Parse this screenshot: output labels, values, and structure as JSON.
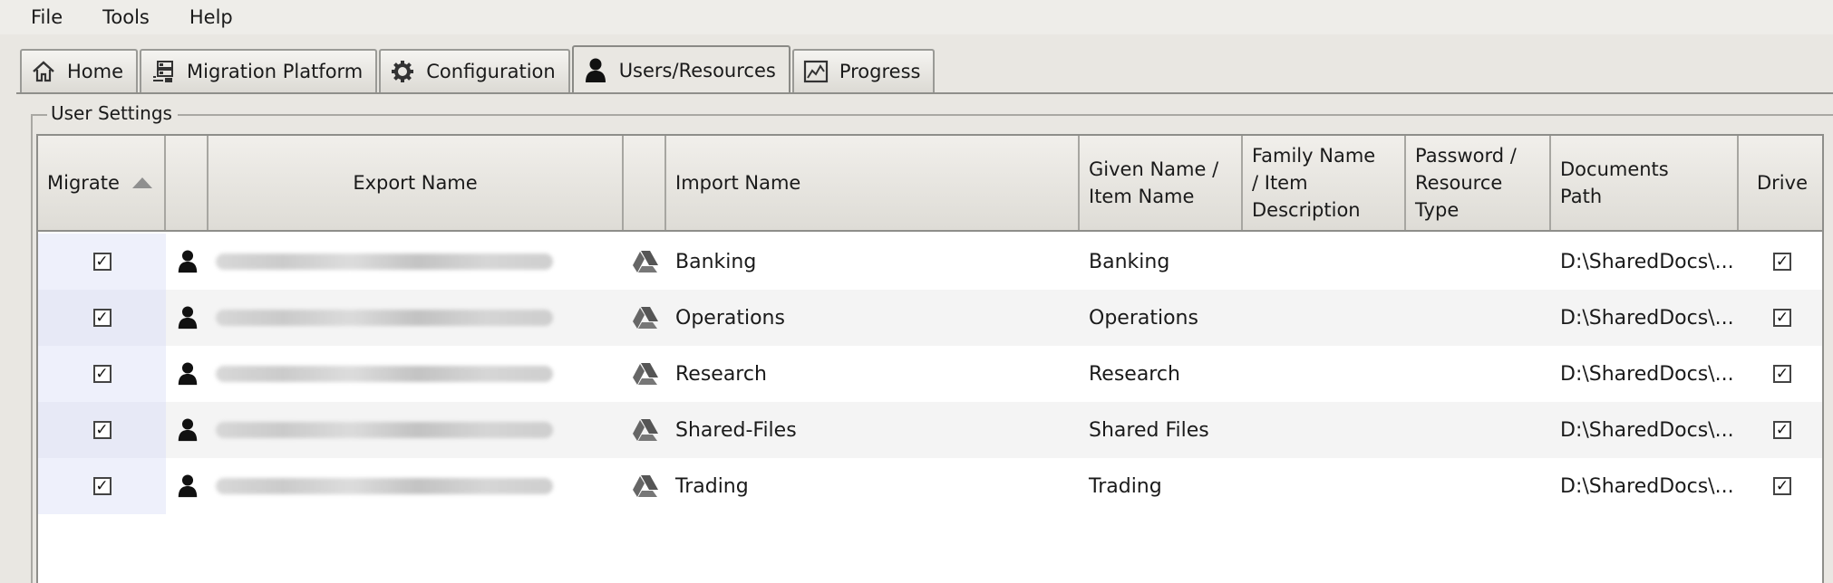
{
  "menu": [
    "File",
    "Tools",
    "Help"
  ],
  "tabs": [
    {
      "label": "Home",
      "icon": "home-icon"
    },
    {
      "label": "Migration Platform",
      "icon": "migration-platform-icon"
    },
    {
      "label": "Configuration",
      "icon": "gear-icon"
    },
    {
      "label": "Users/Resources",
      "icon": "user-icon",
      "active": true
    },
    {
      "label": "Progress",
      "icon": "progress-icon"
    }
  ],
  "group_title": "User Settings",
  "table": {
    "columns": {
      "migrate": "Migrate",
      "export_name": "Export Name",
      "import_name": "Import Name",
      "given_name_l1": "Given Name /",
      "given_name_l2": "Item Name",
      "family_name_l1": "Family Name",
      "family_name_l2": "/ Item",
      "family_name_l3": "Description",
      "password_l1": "Password /",
      "password_l2": "Resource",
      "password_l3": "Type",
      "documents_l1": "Documents",
      "documents_l2": "Path",
      "drive": "Drive"
    },
    "rows": [
      {
        "migrate": true,
        "import_name": "Banking",
        "given_name": "Banking",
        "documents_path": "D:\\SharedDocs\\...",
        "drive": true
      },
      {
        "migrate": true,
        "import_name": "Operations",
        "given_name": "Operations",
        "documents_path": "D:\\SharedDocs\\...",
        "drive": true
      },
      {
        "migrate": true,
        "import_name": "Research",
        "given_name": "Research",
        "documents_path": "D:\\SharedDocs\\...",
        "drive": true
      },
      {
        "migrate": true,
        "import_name": "Shared-Files",
        "given_name": "Shared Files",
        "documents_path": "D:\\SharedDocs\\...",
        "drive": true
      },
      {
        "migrate": true,
        "import_name": "Trading",
        "given_name": "Trading",
        "documents_path": "D:\\SharedDocs\\...",
        "drive": true
      }
    ]
  },
  "colors": {
    "accent": "#eef0fb",
    "header": "#dedcd6"
  }
}
